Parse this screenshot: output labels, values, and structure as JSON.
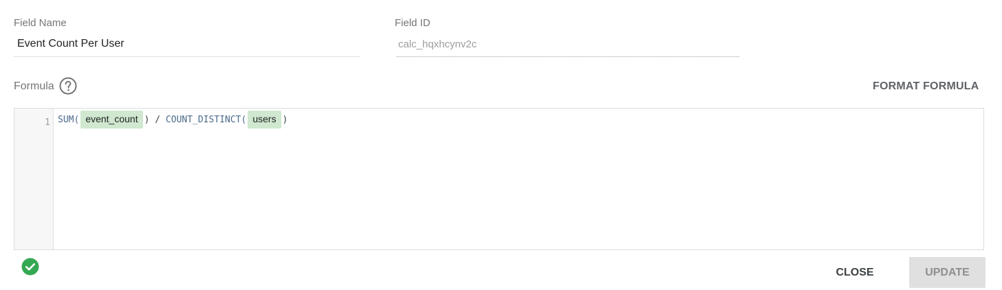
{
  "field_name": {
    "label": "Field Name",
    "value": "Event Count Per User"
  },
  "field_id": {
    "label": "Field ID",
    "value": "calc_hqxhcynv2c"
  },
  "formula": {
    "label": "Formula",
    "help_icon": "help-circle-icon",
    "format_button": "FORMAT FORMULA",
    "line_number": "1",
    "tokens": {
      "fn1": "SUM(",
      "chip1": "event_count",
      "mid": ") / ",
      "fn2": "COUNT_DISTINCT(",
      "chip2": "users",
      "end": ")"
    }
  },
  "status": {
    "icon": "check-circle-icon",
    "color": "#34a853"
  },
  "actions": {
    "close": "CLOSE",
    "update": "UPDATE"
  }
}
